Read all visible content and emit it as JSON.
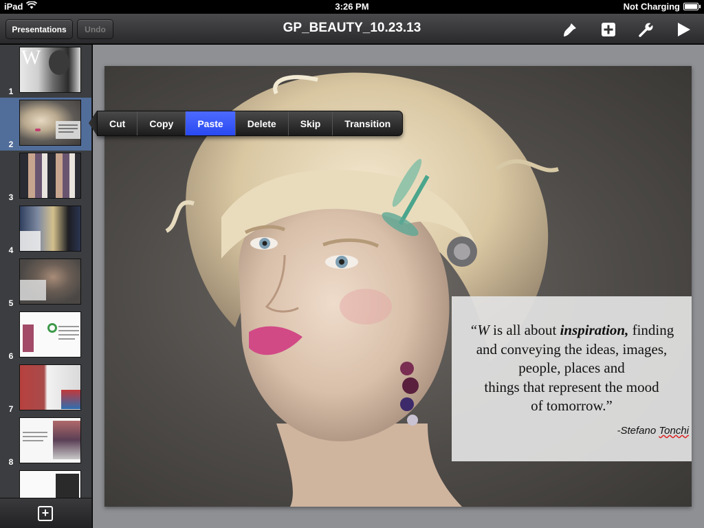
{
  "status_bar": {
    "device": "iPad",
    "time": "3:26 PM",
    "charging": "Not Charging"
  },
  "toolbar": {
    "presentations_label": "Presentations",
    "undo_label": "Undo",
    "title": "GP_BEAUTY_10.23.13",
    "icons": [
      "paintbrush-icon",
      "add-icon",
      "wrench-icon",
      "play-icon"
    ]
  },
  "sidebar": {
    "slides": [
      {
        "number": "1",
        "selected": false,
        "thumb_text": "W"
      },
      {
        "number": "2",
        "selected": true
      },
      {
        "number": "3",
        "selected": false
      },
      {
        "number": "4",
        "selected": false
      },
      {
        "number": "5",
        "selected": false
      },
      {
        "number": "6",
        "selected": false
      },
      {
        "number": "7",
        "selected": false
      },
      {
        "number": "8",
        "selected": false
      }
    ]
  },
  "context_menu": {
    "items": [
      {
        "label": "Cut",
        "active": false
      },
      {
        "label": "Copy",
        "active": false
      },
      {
        "label": "Paste",
        "active": true
      },
      {
        "label": "Delete",
        "active": false
      },
      {
        "label": "Skip",
        "active": false
      },
      {
        "label": "Transition",
        "active": false
      }
    ]
  },
  "slide": {
    "quote": {
      "open_quote": "“",
      "w": "W",
      "is_all_about": " is all about ",
      "inspiration": "inspiration,",
      "rest_line1": " finding",
      "line2": "and conveying the ideas, images,",
      "line3": "people, places and",
      "line4": "things that represent the mood",
      "line5": "of tomorrow.”",
      "attribution_dash": "-Stefano ",
      "attribution_name": "Tonchi"
    }
  },
  "colors": {
    "accent_blue": "#2a49f0",
    "selected_slide": "#516d9a"
  }
}
